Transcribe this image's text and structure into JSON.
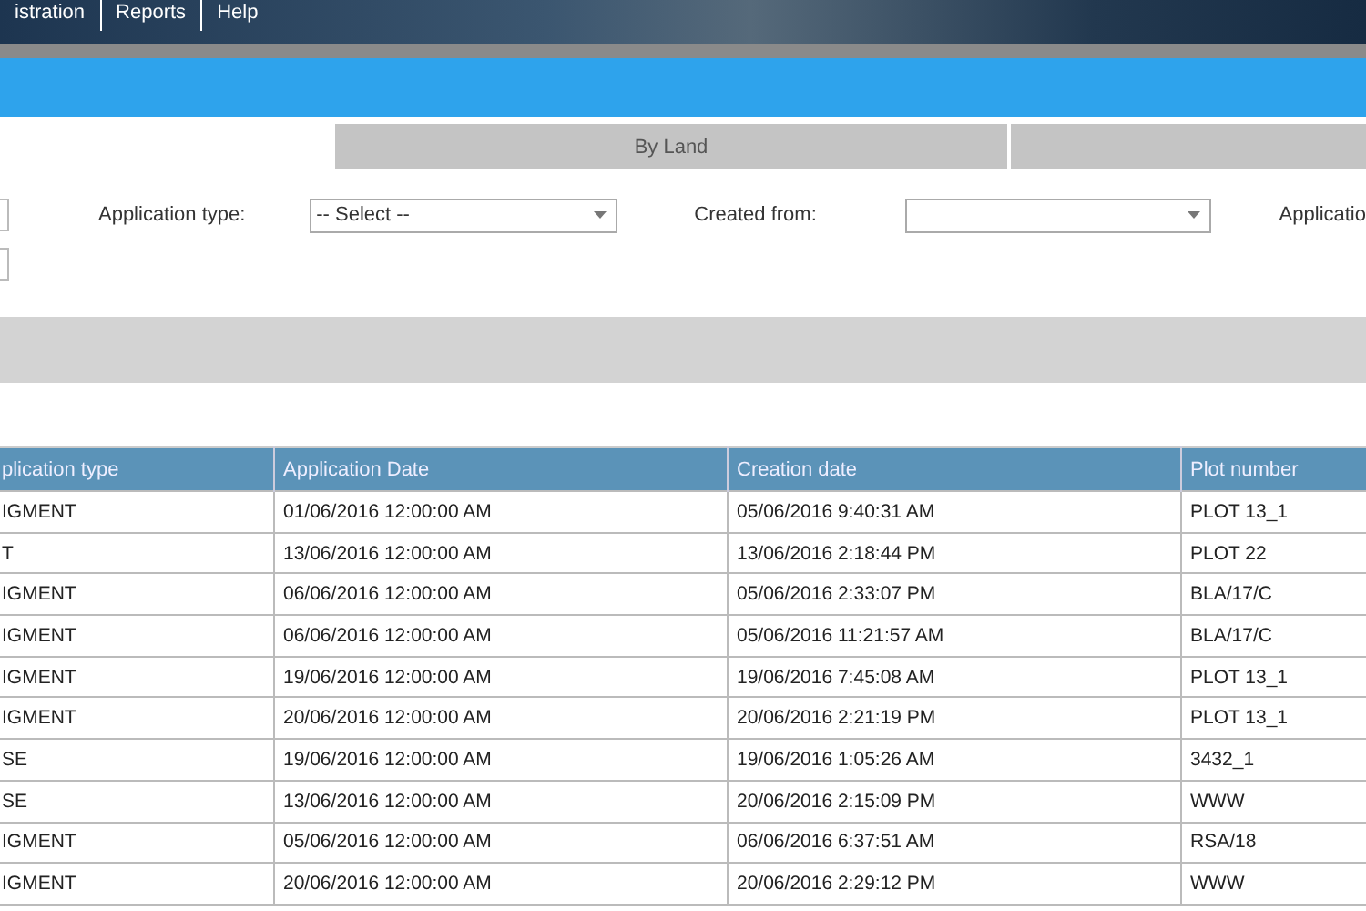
{
  "menu": [
    {
      "label": "istration"
    },
    {
      "label": "Reports"
    },
    {
      "label": "Help"
    }
  ],
  "tabs": [
    {
      "label": "By Land"
    }
  ],
  "filters": [
    {
      "label": "Application type:",
      "value": "-- Select --"
    },
    {
      "label": "Created from:"
    }
  ],
  "cut_label": "Applicatio",
  "table": {
    "columns": [
      "plication type",
      "Application Date",
      "Creation date",
      "Plot number"
    ],
    "rows": [
      [
        "IGMENT",
        "01/06/2016 12:00:00 AM",
        "05/06/2016 9:40:31 AM",
        "PLOT 13_1"
      ],
      [
        "T",
        "13/06/2016 12:00:00 AM",
        "13/06/2016 2:18:44 PM",
        "PLOT 22"
      ],
      [
        "IGMENT",
        "06/06/2016 12:00:00 AM",
        "05/06/2016 2:33:07 PM",
        "BLA/17/C"
      ],
      [
        "IGMENT",
        "06/06/2016 12:00:00 AM",
        "05/06/2016 11:21:57 AM",
        "BLA/17/C"
      ],
      [
        "IGMENT",
        "19/06/2016 12:00:00 AM",
        "19/06/2016 7:45:08 AM",
        "PLOT 13_1"
      ],
      [
        "IGMENT",
        "20/06/2016 12:00:00 AM",
        "20/06/2016 2:21:19 PM",
        "PLOT 13_1"
      ],
      [
        "SE",
        "19/06/2016 12:00:00 AM",
        "19/06/2016 1:05:26 AM",
        "3432_1"
      ],
      [
        "SE",
        "13/06/2016 12:00:00 AM",
        "20/06/2016 2:15:09 PM",
        "WWW"
      ],
      [
        "IGMENT",
        "05/06/2016 12:00:00 AM",
        "06/06/2016 6:37:51 AM",
        "RSA/18"
      ],
      [
        "IGMENT",
        "20/06/2016 12:00:00 AM",
        "20/06/2016 2:29:12 PM",
        "WWW"
      ]
    ]
  }
}
